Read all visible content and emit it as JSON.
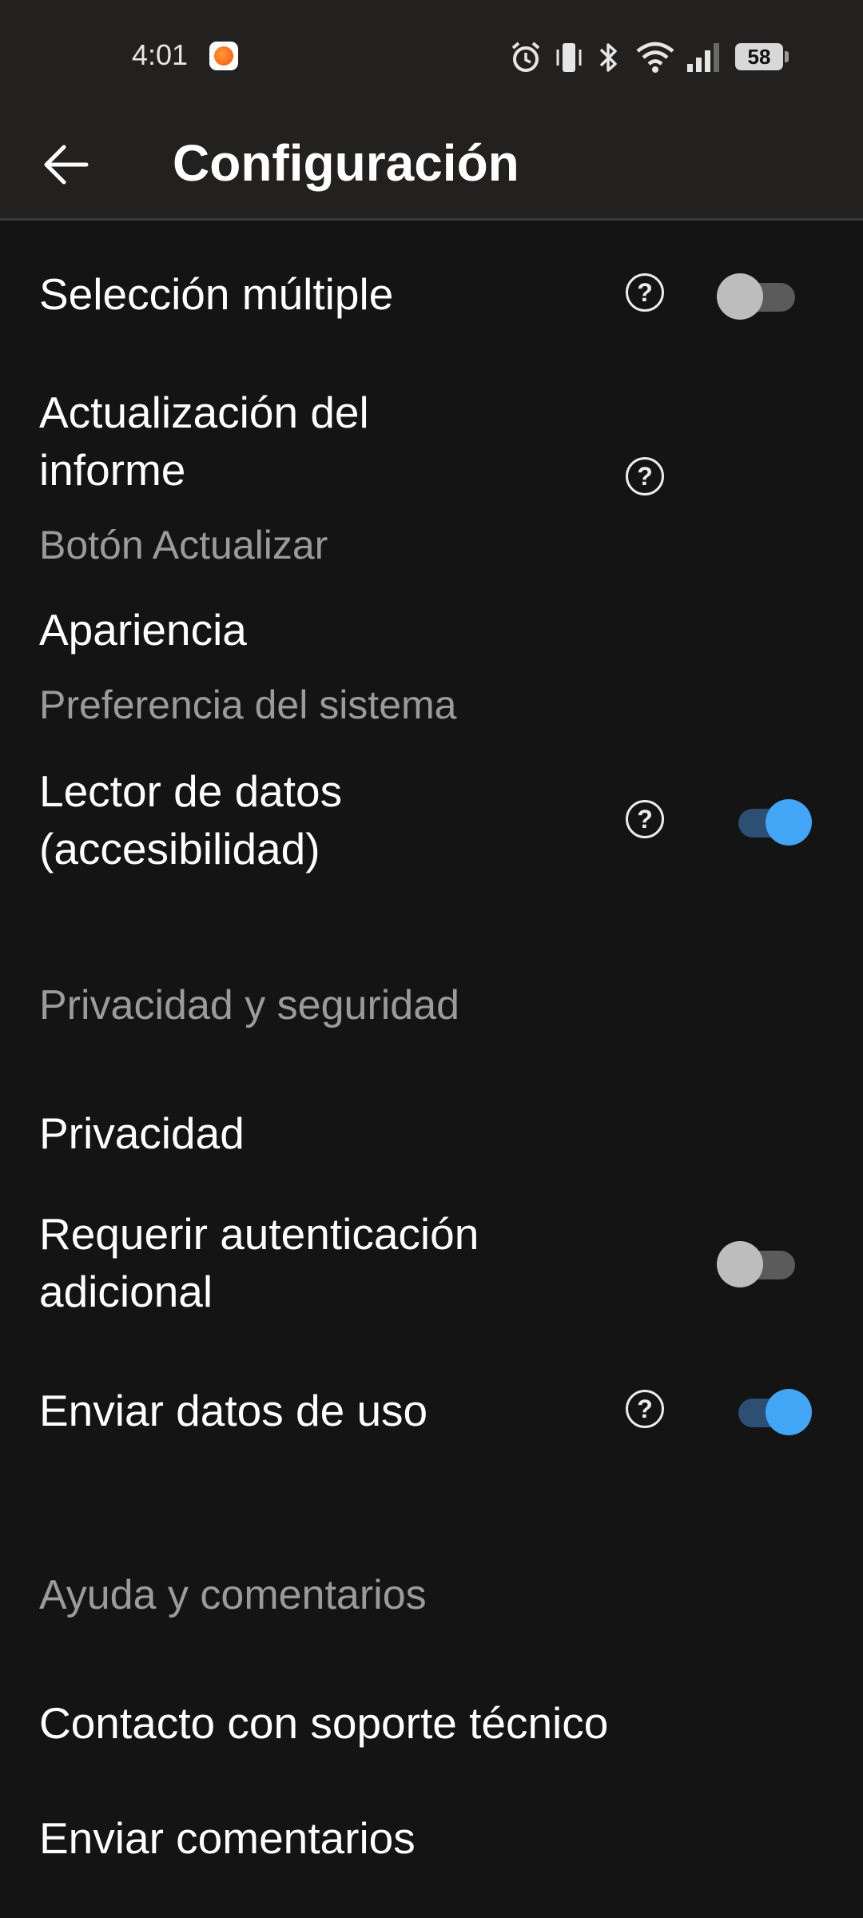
{
  "status_bar": {
    "time": "4:01",
    "battery": "58",
    "icons": [
      "alarm-icon",
      "vibrate-icon",
      "bluetooth-icon",
      "wifi-icon",
      "signal-icon",
      "battery-icon"
    ]
  },
  "header": {
    "title": "Configuración",
    "back_icon": "arrow-left-icon"
  },
  "settings": {
    "multi_select": {
      "label": "Selección múltiple",
      "help": "?",
      "toggle_on": false
    },
    "report_refresh": {
      "label_line1": "Actualización del",
      "label_line2": "informe",
      "value": "Botón Actualizar",
      "help": "?"
    },
    "appearance": {
      "label": "Apariencia",
      "value": "Preferencia del sistema"
    },
    "data_reader": {
      "label_line1": "Lector de datos",
      "label_line2": "(accesibilidad)",
      "help": "?",
      "toggle_on": true
    }
  },
  "privacy_section": {
    "header": "Privacidad y seguridad",
    "privacy": {
      "label": "Privacidad"
    },
    "extra_auth": {
      "label_line1": "Requerir autenticación",
      "label_line2": "adicional",
      "toggle_on": false
    },
    "usage_data": {
      "label": "Enviar datos de uso",
      "help": "?",
      "toggle_on": true
    }
  },
  "help_section": {
    "header": "Ayuda y comentarios",
    "contact_support": {
      "label": "Contacto con soporte técnico"
    },
    "send_feedback": {
      "label": "Enviar comentarios"
    }
  },
  "colors": {
    "background": "#141414",
    "app_bar": "#222120",
    "accent": "#42a5f5",
    "secondary_text": "#9b9b9b"
  }
}
